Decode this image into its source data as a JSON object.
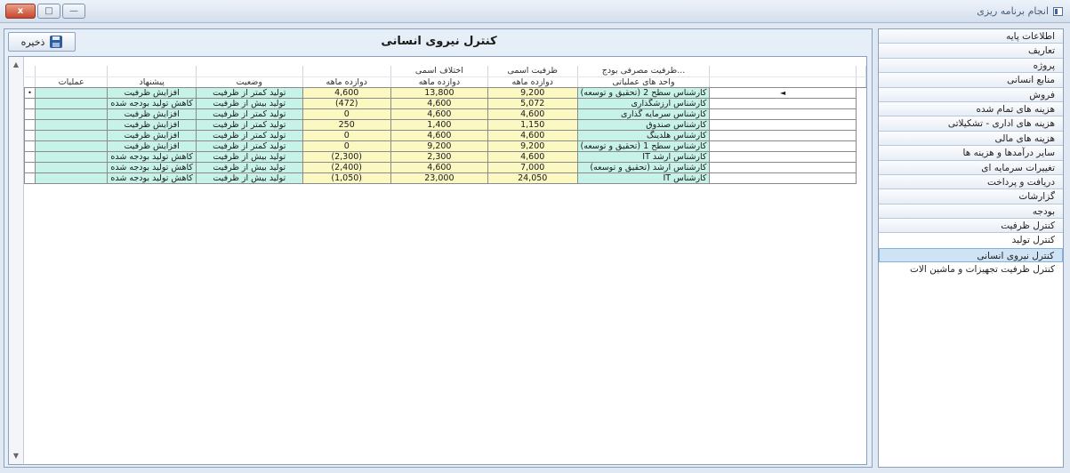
{
  "window": {
    "title": "انجام برنامه ریزی",
    "controls": [
      "x",
      "□",
      "—"
    ]
  },
  "toolbar": {
    "save_label": "ذخیره"
  },
  "page_title": "کنترل نیروی انسانی",
  "nav": {
    "items": [
      "اطلاعات پایه",
      "تعاریف",
      "پروژه",
      "منابع انسانی",
      "فروش",
      "هزینه های تمام شده",
      "هزینه های اداری - تشکیلاتی",
      "هزینه های مالی",
      "سایر درآمدها و هزینه ها",
      "تغییرات سرمایه ای",
      "دریافت و پرداخت",
      "گزارشات",
      "بودجه",
      "کنترل ظرفیت",
      "کنترل تولید",
      "کنترل نیروی انسانی",
      "کنترل ظرفیت تجهیزات و ماشین الات"
    ],
    "active_index": 15
  },
  "table": {
    "group_headers": {
      "budget": "ظرفیت مصرفی بودج...",
      "nominal": "ظرفیت اسمی",
      "diff": "اختلاف اسمی"
    },
    "columns": {
      "unit": "واحد های عملیاتی",
      "budget": "دوازده ماهه",
      "nominal": "دوازده ماهه",
      "diff": "دوازده ماهه",
      "status": "وضعیت",
      "suggestion": "پیشنهاد",
      "ops": "عملیات"
    },
    "rows": [
      {
        "unit": "کارشناس سطح 2 (تحقیق و توسعه)",
        "budget": "9,200",
        "nominal": "13,800",
        "diff": "4,600",
        "status": "تولید کمتر از ظرفیت",
        "suggestion": "افزایش ظرفیت",
        "ops": "",
        "ind_right": "◄",
        "ind_left": "•"
      },
      {
        "unit": "کارشناس ارزشگذاری",
        "budget": "5,072",
        "nominal": "4,600",
        "diff": "(472)",
        "status": "تولید بیش از ظرفیت",
        "suggestion": "کاهش تولید بودجه شده",
        "ops": "",
        "ind_right": "",
        "ind_left": ""
      },
      {
        "unit": "کارشناس سرمایه گذاری",
        "budget": "4,600",
        "nominal": "4,600",
        "diff": "0",
        "status": "تولید کمتر از ظرفیت",
        "suggestion": "افزایش ظرفیت",
        "ops": "",
        "ind_right": "",
        "ind_left": ""
      },
      {
        "unit": "کارشناس صندوق",
        "budget": "1,150",
        "nominal": "1,400",
        "diff": "250",
        "status": "تولید کمتر از ظرفیت",
        "suggestion": "افزایش ظرفیت",
        "ops": "",
        "ind_right": "",
        "ind_left": ""
      },
      {
        "unit": "کارشناس هلدینگ",
        "budget": "4,600",
        "nominal": "4,600",
        "diff": "0",
        "status": "تولید کمتر از ظرفیت",
        "suggestion": "افزایش ظرفیت",
        "ops": "",
        "ind_right": "",
        "ind_left": ""
      },
      {
        "unit": "کارشناس سطح 1 (تحقیق و توسعه)",
        "budget": "9,200",
        "nominal": "9,200",
        "diff": "0",
        "status": "تولید کمتر از ظرفیت",
        "suggestion": "افزایش ظرفیت",
        "ops": "",
        "ind_right": "",
        "ind_left": ""
      },
      {
        "unit": "کارشناس ارشد IT",
        "budget": "4,600",
        "nominal": "2,300",
        "diff": "(2,300)",
        "status": "تولید بیش از ظرفیت",
        "suggestion": "کاهش تولید بودجه شده",
        "ops": "",
        "ind_right": "",
        "ind_left": ""
      },
      {
        "unit": "کارشناس ارشد (تحقیق و توسعه)",
        "budget": "7,000",
        "nominal": "4,600",
        "diff": "(2,400)",
        "status": "تولید بیش از ظرفیت",
        "suggestion": "کاهش تولید بودجه شده",
        "ops": "",
        "ind_right": "",
        "ind_left": ""
      },
      {
        "unit": "کارشناس IT",
        "budget": "24,050",
        "nominal": "23,000",
        "diff": "(1,050)",
        "status": "تولید بیش از ظرفیت",
        "suggestion": "کاهش تولید بودجه شده",
        "ops": "",
        "ind_right": "",
        "ind_left": ""
      }
    ]
  },
  "colors": {
    "teal_cell": "#c7f2e8",
    "yellow_cell": "#fbf8c2",
    "active_nav": "#cfe3f7"
  }
}
